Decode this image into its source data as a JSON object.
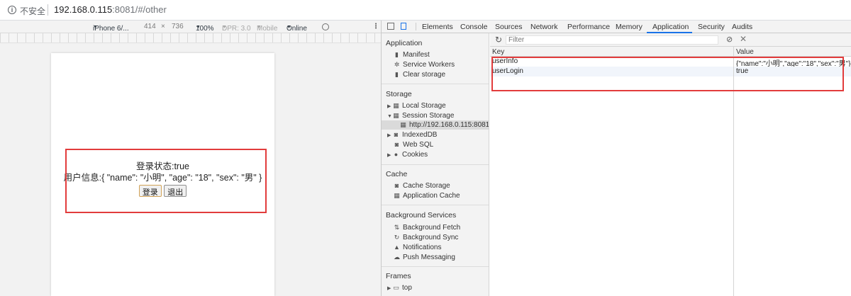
{
  "address_bar": {
    "security_label": "不安全",
    "url_host": "192.168.0.115",
    "url_rest": ":8081/#/other"
  },
  "device_toolbar": {
    "device": "iPhone 6/...",
    "width": "414",
    "times": "×",
    "height": "736",
    "zoom": "100%",
    "dpr": "DPR: 3.0",
    "mobile": "Mobile",
    "network": "Online"
  },
  "app": {
    "status_line": "登录状态:true",
    "userinfo_line": "用户信息:{ \"name\": \"小明\", \"age\": \"18\", \"sex\": \"男\" }",
    "login_button": "登录",
    "logout_button": "退出"
  },
  "devtools": {
    "tabs": [
      "Elements",
      "Console",
      "Sources",
      "Network",
      "Performance",
      "Memory",
      "Application",
      "Security",
      "Audits"
    ],
    "active_tab": "Application",
    "sidebar": {
      "sections": [
        {
          "title": "Application",
          "items": [
            "Manifest",
            "Service Workers",
            "Clear storage"
          ]
        },
        {
          "title": "Storage",
          "items": [
            "Local Storage",
            "Session Storage",
            "http://192.168.0.115:8081",
            "IndexedDB",
            "Web SQL",
            "Cookies"
          ]
        },
        {
          "title": "Cache",
          "items": [
            "Cache Storage",
            "Application Cache"
          ]
        },
        {
          "title": "Background Services",
          "items": [
            "Background Fetch",
            "Background Sync",
            "Notifications",
            "Push Messaging"
          ]
        },
        {
          "title": "Frames",
          "items": [
            "top"
          ]
        }
      ]
    },
    "filter_placeholder": "Filter",
    "table": {
      "columns": [
        "Key",
        "Value"
      ],
      "rows": [
        {
          "key": "userInfo",
          "value": "{\"name\":\"小明\",\"age\":\"18\",\"sex\":\"男\"}"
        },
        {
          "key": "userLogin",
          "value": "true"
        }
      ]
    }
  },
  "colors": {
    "highlight": "#e23c3c",
    "active_tab_underline": "#1a73e8"
  }
}
